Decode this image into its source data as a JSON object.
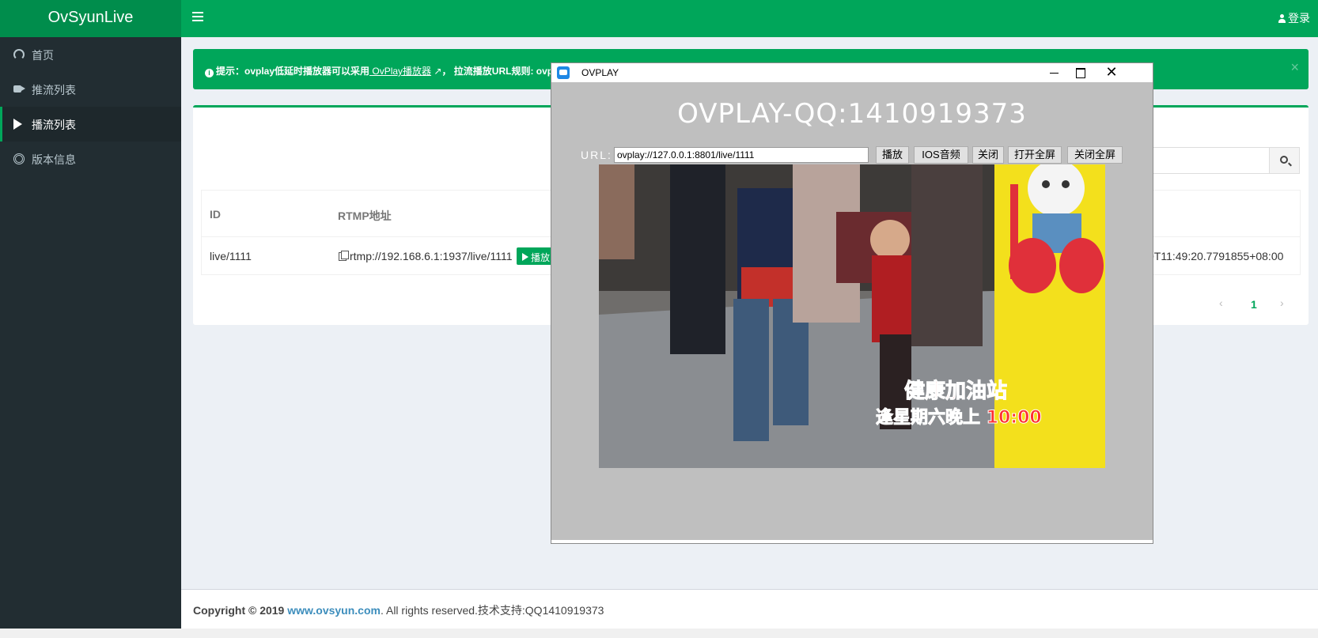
{
  "app": {
    "title": "OvSyunLive",
    "login_label": "登录"
  },
  "sidebar": {
    "items": [
      {
        "label": "首页",
        "icon": "dashboard-icon"
      },
      {
        "label": "推流列表",
        "icon": "video-camera-icon"
      },
      {
        "label": "播流列表",
        "icon": "play-icon",
        "active": true
      },
      {
        "label": "版本信息",
        "icon": "life-ring-icon"
      }
    ]
  },
  "alert": {
    "prefix": "提示：",
    "text_before_link": "ovplay低延时播放器可以采用",
    "link": " OvPlay播放器",
    "text_after_link": "， 拉流播放URL规则: ovpl",
    "close": "×"
  },
  "table": {
    "headers": {
      "id": "ID",
      "rtmp": "RTMP地址"
    },
    "rows": [
      {
        "id": "live/1111",
        "rtmp": "rtmp://192.168.6.1:1937/live/1111",
        "time": "0T11:49:20.7791855+08:00"
      }
    ],
    "play_badge": "播放"
  },
  "pagination": {
    "prev": "‹",
    "page": "1",
    "next": "›"
  },
  "footer": {
    "prefix": "Copyright © 2019 ",
    "link": "www.ovsyun.com",
    "suffix": ". All rights reserved.技术支持:QQ1410919373"
  },
  "player_window": {
    "title": "OVPLAY",
    "heading": "OVPLAY-QQ:1410919373",
    "url_label": "URL:",
    "url_value": "ovplay://127.0.0.1:8801/live/1111",
    "buttons": [
      "播放",
      "IOS音频",
      "关闭",
      "打开全屏",
      "关闭全屏"
    ],
    "close_glyph": "✕"
  },
  "video_overlay": {
    "line1": "健康加油站",
    "line2": "逢星期六晚上 10:00"
  },
  "colors": {
    "primary_green": "#00a65a",
    "sidebar_bg": "#222d32",
    "link_blue": "#3c8dbc"
  }
}
